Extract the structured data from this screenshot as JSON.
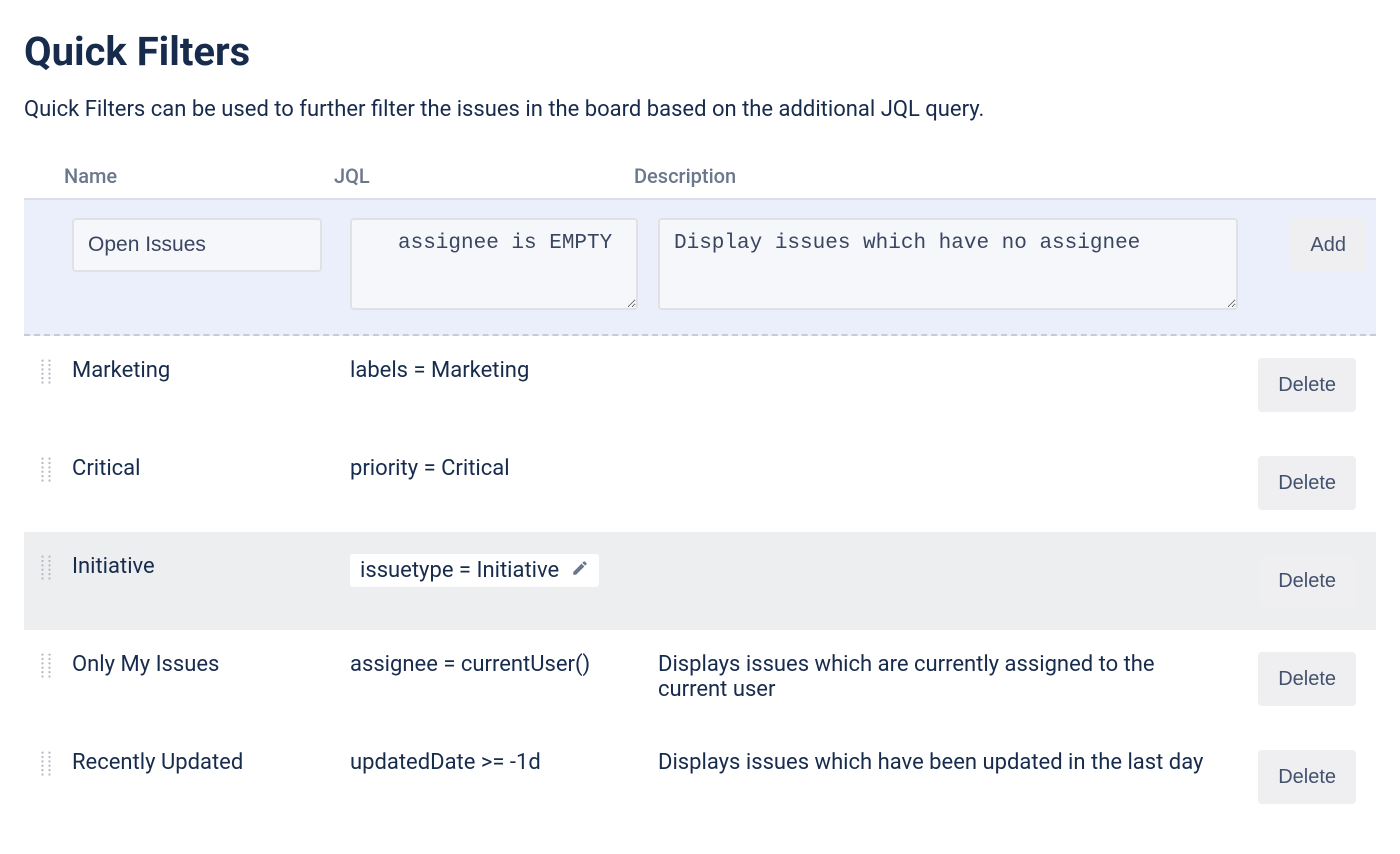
{
  "page": {
    "title": "Quick Filters",
    "description": "Quick Filters can be used to further filter the issues in the board based on the additional JQL query."
  },
  "columns": {
    "name": "Name",
    "jql": "JQL",
    "description": "Description"
  },
  "edit_row": {
    "name_value": "Open Issues",
    "jql_value": "assignee is EMPTY",
    "description_value": "Display issues which have no assignee",
    "add_label": "Add"
  },
  "filters": [
    {
      "name": "Marketing",
      "jql": "labels = Marketing",
      "description": "",
      "hovered": false,
      "editing_jql": false
    },
    {
      "name": "Critical",
      "jql": "priority = Critical",
      "description": "",
      "hovered": false,
      "editing_jql": false
    },
    {
      "name": "Initiative",
      "jql": "issuetype = Initiative",
      "description": "",
      "hovered": true,
      "editing_jql": true
    },
    {
      "name": "Only My Issues",
      "jql": "assignee = currentUser()",
      "description": "Displays issues which are currently assigned to the current user",
      "hovered": false,
      "editing_jql": false
    },
    {
      "name": "Recently Updated",
      "jql": "updatedDate >= -1d",
      "description": "Displays issues which have been updated in the last day",
      "hovered": false,
      "editing_jql": false
    }
  ],
  "buttons": {
    "delete": "Delete"
  }
}
